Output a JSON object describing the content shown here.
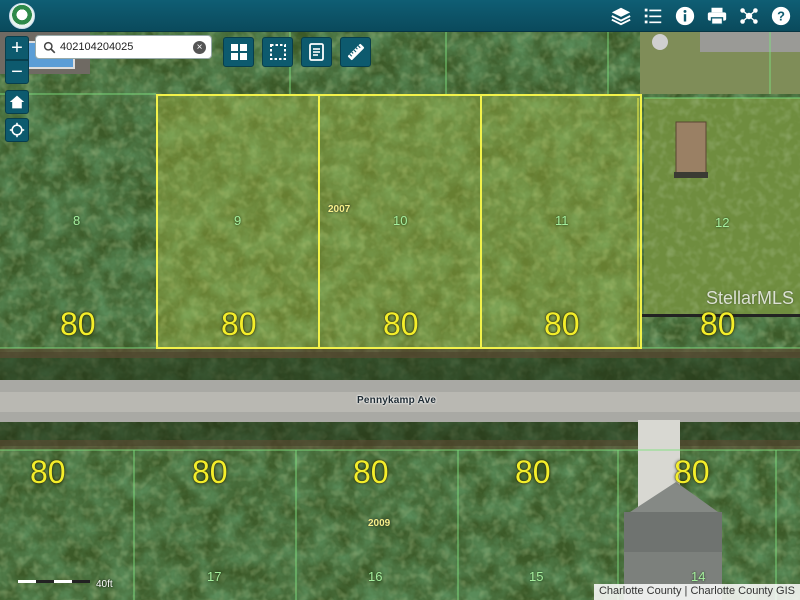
{
  "search": {
    "value": "402104204025",
    "placeholder": ""
  },
  "top_icons": [
    "layers-icon",
    "legend-list-icon",
    "info-icon",
    "print-icon",
    "share-icon",
    "help-icon"
  ],
  "tools": [
    "basemap-grid-icon",
    "select-area-icon",
    "notes-icon",
    "measure-ruler-icon"
  ],
  "street": "Pennykamp Ave",
  "lot_width": "80",
  "lots_north": [
    "8",
    "9",
    "10",
    "11",
    "12"
  ],
  "lots_south": [
    "17",
    "16",
    "15",
    "14"
  ],
  "years": {
    "north": "2007",
    "south": "2009"
  },
  "watermark": "StellarMLS",
  "scale": {
    "label": "40ft",
    "ticks": "0"
  },
  "attribution": "Charlotte County | Charlotte County GIS",
  "colors": {
    "toolbar": "#0d5a6e",
    "selection": "#f2f24a",
    "parcel_line": "#7ee07e",
    "dimension_text": "#f4ee2a"
  }
}
